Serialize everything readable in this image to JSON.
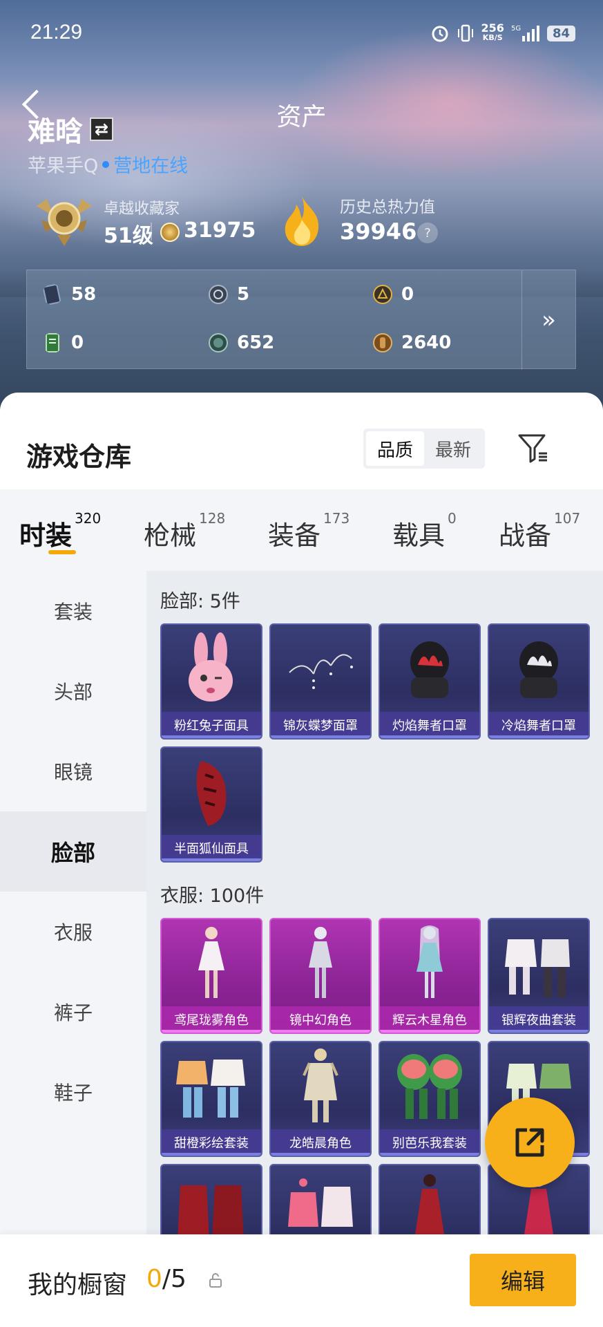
{
  "status_bar": {
    "time": "21:29",
    "speed": "256",
    "speed_unit": "KB/S",
    "network": "5G",
    "battery": "84"
  },
  "header": {
    "title": "资产",
    "username": "难晗",
    "platform": "苹果手Q",
    "online_status": "营地在线",
    "rank_label": "卓越收藏家",
    "rank_level": "51级",
    "rank_coins": "31975",
    "heat_label": "历史总热力值",
    "heat_value": "39946",
    "help": "?"
  },
  "resources": [
    {
      "icon": "card-icon",
      "value": "58",
      "color": "#5a6d8f"
    },
    {
      "icon": "silver-token-icon",
      "value": "5",
      "color": "#6f7b8c"
    },
    {
      "icon": "gold-token-icon",
      "value": "0",
      "color": "#c9952e"
    },
    {
      "icon": "green-ticket-icon",
      "value": "0",
      "color": "#3f8f4a"
    },
    {
      "icon": "teal-coin-icon",
      "value": "652",
      "color": "#3e6a63"
    },
    {
      "icon": "bronze-coin-icon",
      "value": "2640",
      "color": "#b07a32"
    }
  ],
  "resources_more": "»",
  "warehouse": {
    "title": "游戏仓库",
    "sort_options": [
      "品质",
      "最新"
    ],
    "tabs": [
      {
        "label": "时装",
        "count": "320"
      },
      {
        "label": "枪械",
        "count": "128"
      },
      {
        "label": "装备",
        "count": "173"
      },
      {
        "label": "载具",
        "count": "0"
      },
      {
        "label": "战备",
        "count": "107"
      }
    ],
    "categories": [
      "套装",
      "头部",
      "眼镜",
      "脸部",
      "衣服",
      "裤子",
      "鞋子"
    ],
    "sections": [
      {
        "title": "脸部: 5件",
        "items": [
          "粉红兔子面具",
          "锦灰蝶梦面罩",
          "灼焰舞者口罩",
          "冷焰舞者口罩",
          "半面狐仙面具"
        ]
      },
      {
        "title": "衣服: 100件",
        "items": [
          "鸢尾珑雾角色",
          "镜中幻角色",
          "辉云木星角色",
          "银辉夜曲套装",
          "甜橙彩绘套装",
          "龙皓晨角色",
          "别芭乐我套装",
          "",
          "",
          "",
          "",
          ""
        ]
      }
    ]
  },
  "bottom": {
    "label": "我的橱窗",
    "current": "0",
    "total": "/5",
    "edit": "编辑"
  },
  "colors": {
    "accent": "#f7b01a",
    "online": "#4aa3ff",
    "card_blue": "#2d2f62",
    "card_pink": "#8d2497"
  }
}
